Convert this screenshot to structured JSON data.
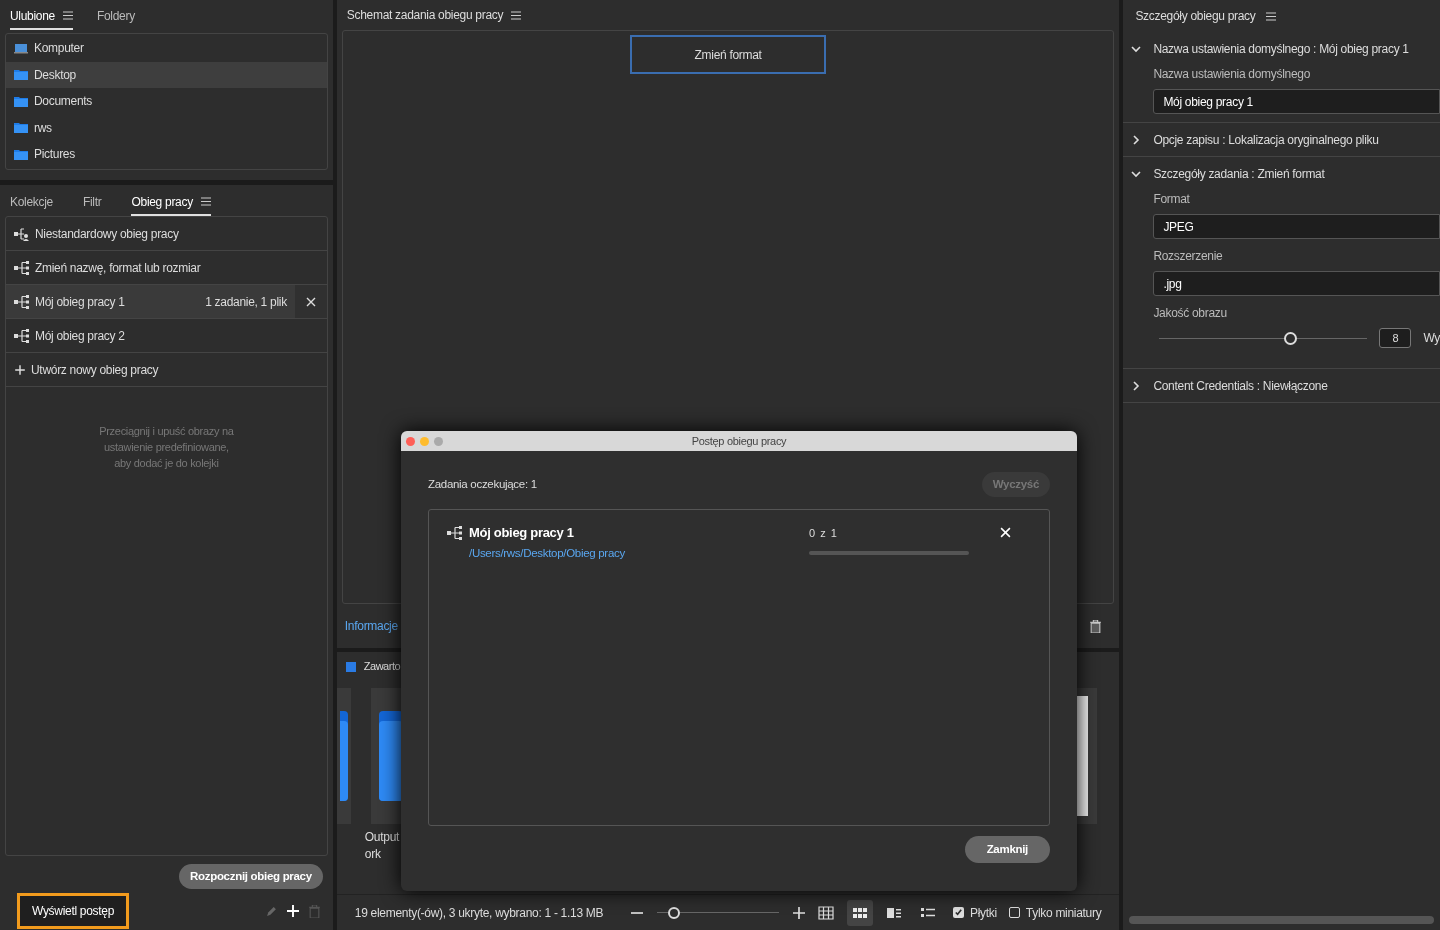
{
  "favorites_panel": {
    "tabs": [
      {
        "label": "Ulubione",
        "selected": true
      },
      {
        "label": "Foldery",
        "selected": false
      }
    ],
    "items": [
      {
        "label": "Komputer",
        "kind": "computer",
        "selected": false
      },
      {
        "label": "Desktop",
        "kind": "folder",
        "selected": true
      },
      {
        "label": "Documents",
        "kind": "folder",
        "selected": false
      },
      {
        "label": "rws",
        "kind": "folder",
        "selected": false
      },
      {
        "label": "Pictures",
        "kind": "folder",
        "selected": false
      }
    ]
  },
  "workflow_panel": {
    "tabs": [
      {
        "label": "Kolekcje",
        "selected": false
      },
      {
        "label": "Filtr",
        "selected": false
      },
      {
        "label": "Obieg pracy",
        "selected": true
      }
    ],
    "items": [
      {
        "label": "Niestandardowy obieg pracy",
        "kind": "custom",
        "selected": false
      },
      {
        "label": "Zmień nazwę, format lub rozmiar",
        "kind": "workflow",
        "selected": false
      },
      {
        "label": "Mój obieg pracy 1",
        "kind": "workflow",
        "selected": true,
        "info": "1 zadanie, 1 plik"
      },
      {
        "label": "Mój obieg pracy 2",
        "kind": "workflow",
        "selected": false
      },
      {
        "label": "Utwórz nowy obieg pracy",
        "kind": "create",
        "selected": false
      }
    ],
    "hint": "Przeciągnij i upuść obrazy na\nustawienie predefiniowane,\naby dodać je do kolejki",
    "start_button": "Rozpocznij obieg pracy",
    "progress_button": "Wyświetl postęp"
  },
  "schema_panel": {
    "title": "Schemat zadania obiegu pracy",
    "task": "Zmień format",
    "info_link": "Informacje"
  },
  "content_panel": {
    "title": "Zawarto",
    "tiles": [
      {
        "kind": "folder"
      },
      {
        "kind": "folder"
      },
      {
        "kind": "image"
      }
    ],
    "captions": [
      "Output",
      "ork"
    ]
  },
  "status_bar": {
    "text": "19 elementy(-ów), 3 ukryte, wybrano: 1 - 1.13 MB",
    "zoom": {
      "level": 0.14
    },
    "views": [
      {
        "kind": "grid",
        "selected": false
      },
      {
        "kind": "tiles",
        "selected": true
      },
      {
        "kind": "filmstrip",
        "selected": false
      },
      {
        "kind": "list",
        "selected": false
      }
    ],
    "options": [
      {
        "label": "Płytki",
        "checked": true
      },
      {
        "label": "Tylko miniatury",
        "checked": false
      }
    ]
  },
  "details_panel": {
    "title": "Szczegóły obiegu pracy",
    "sections": [
      {
        "label": "Nazwa ustawienia domyślnego : Mój obieg pracy 1",
        "expanded": true,
        "fields": [
          {
            "kind": "text",
            "label": "Nazwa ustawienia domyślnego",
            "value": "Mój obieg pracy 1"
          }
        ]
      },
      {
        "label": "Opcje zapisu : Lokalizacja oryginalnego pliku",
        "expanded": false
      },
      {
        "label": "Szczegóły zadania : Zmień format",
        "expanded": true,
        "fields": [
          {
            "kind": "select",
            "label": "Format",
            "value": "JPEG"
          },
          {
            "kind": "select",
            "label": "Rozszerzenie",
            "value": ".jpg"
          },
          {
            "kind": "slider",
            "label": "Jakość obrazu",
            "level": 0.63,
            "value": "8",
            "suffix": "Wy"
          }
        ]
      },
      {
        "label": "Content Credentials : Niewłączone",
        "expanded": false
      }
    ]
  },
  "dialog": {
    "title": "Postęp obiegu pracy",
    "pending": "Zadania oczekujące: 1",
    "clear_button": "Wyczyść",
    "jobs": [
      {
        "name": "Mój obieg pracy 1",
        "path": "/Users/rws/Desktop/Obieg pracy",
        "count": "0 z 1",
        "level": 0
      }
    ],
    "close_button": "Zamknij"
  }
}
